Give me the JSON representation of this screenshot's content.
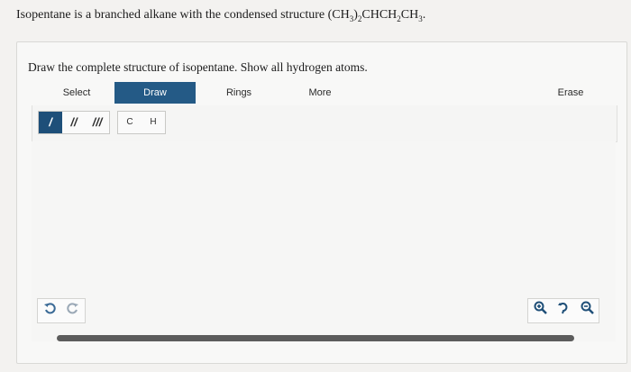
{
  "question": {
    "prefix": "Isopentane is a branched alkane with the condensed structure (CH",
    "sub1": "3",
    "mid1": ")",
    "sub2": "2",
    "mid2": "CHCH",
    "sub3": "2",
    "mid3": "CH",
    "sub4": "3",
    "suffix": "."
  },
  "prompt": "Draw the complete structure of isopentane. Show all hydrogen atoms.",
  "toolbar": {
    "tabs": [
      {
        "label": "Select",
        "active": false
      },
      {
        "label": "Draw",
        "active": true
      },
      {
        "label": "Rings",
        "active": false
      },
      {
        "label": "More",
        "active": false
      },
      {
        "label": "Erase",
        "active": false
      }
    ]
  },
  "tools": {
    "bonds": [
      {
        "label": "/",
        "name": "single-bond",
        "active": true
      },
      {
        "label": "//",
        "name": "double-bond",
        "active": false
      },
      {
        "label": "///",
        "name": "triple-bond",
        "active": false
      }
    ],
    "atoms": [
      "C",
      "H"
    ]
  },
  "canvas_controls": {
    "undo_icon": "undo-icon",
    "redo_icon": "redo-icon",
    "zoom_in_icon": "zoom-in-icon",
    "reset_icon": "reset-zoom-icon",
    "zoom_out_icon": "zoom-out-icon"
  },
  "colors": {
    "accent": "#245a86",
    "active_bond": "#1e4f79",
    "background": "#f3f2f0"
  }
}
